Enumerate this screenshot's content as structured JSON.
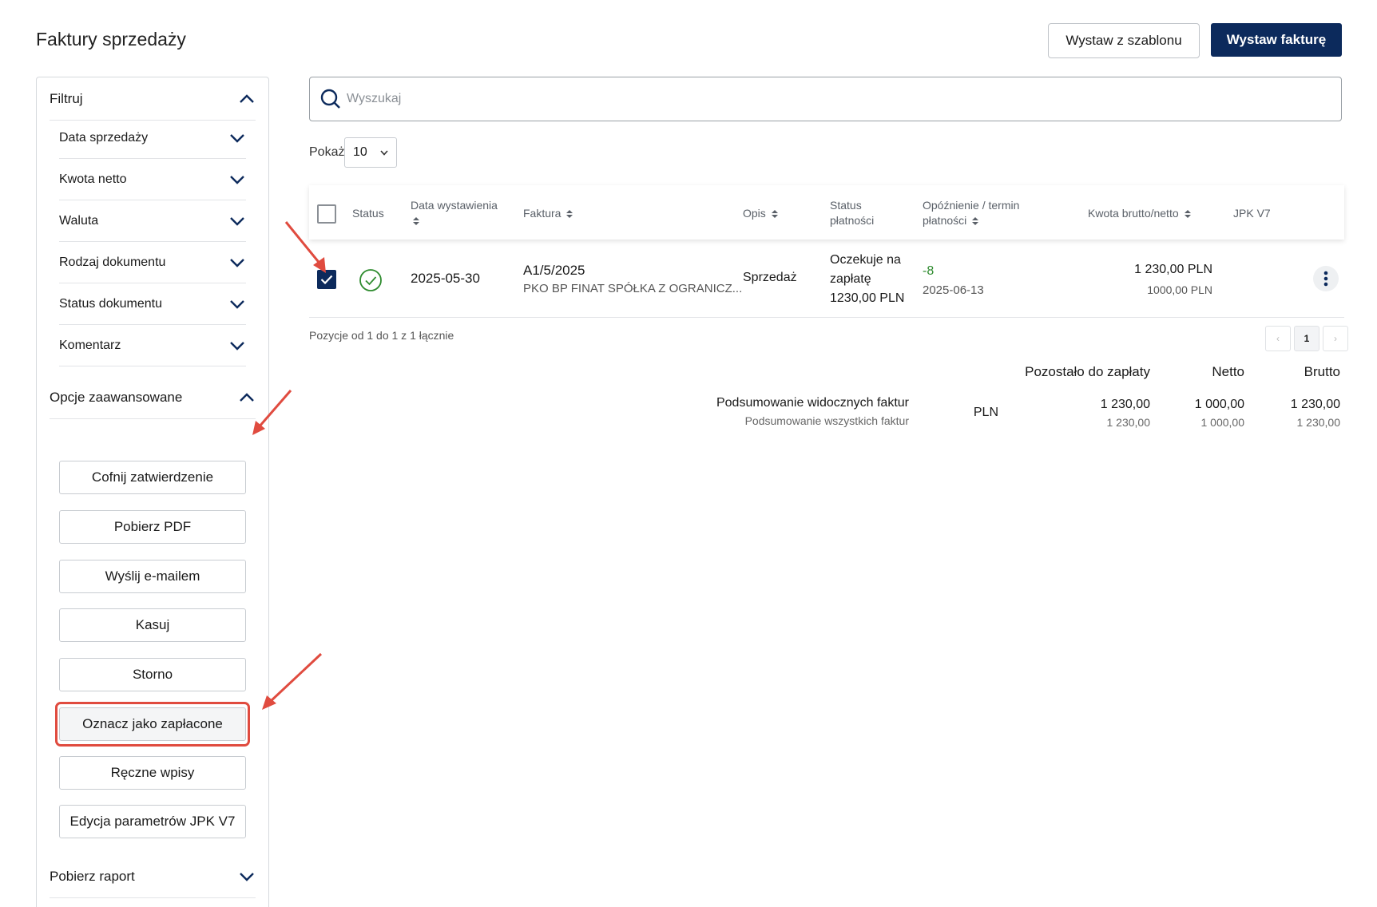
{
  "header": {
    "title": "Faktury sprzedaży",
    "btn_template": "Wystaw z szablonu",
    "btn_issue": "Wystaw fakturę"
  },
  "sidebar": {
    "filter_title": "Filtruj",
    "filters": [
      "Data sprzedaży",
      "Kwota netto",
      "Waluta",
      "Rodzaj dokumentu",
      "Status dokumentu",
      "Komentarz"
    ],
    "advanced_title": "Opcje zaawansowane",
    "advanced_buttons": [
      "Cofnij zatwierdzenie",
      "Pobierz PDF",
      "Wyślij e-mailem",
      "Kasuj",
      "Storno",
      "Oznacz jako zapłacone",
      "Ręczne wpisy",
      "Edycja parametrów JPK V7"
    ],
    "report_title": "Pobierz raport"
  },
  "search": {
    "placeholder": "Wyszukaj"
  },
  "pagesize": {
    "label": "Pokaż",
    "value": "10"
  },
  "table": {
    "headers": {
      "status": "Status",
      "date_line1": "Data wystawienia",
      "invoice": "Faktura",
      "desc": "Opis",
      "pay_status_line1": "Status",
      "pay_status_line2": "płatności",
      "delay_line1": "Opóźnienie / termin",
      "delay_line2": "płatności",
      "amount": "Kwota brutto/netto",
      "jpk": "JPK V7"
    },
    "row": {
      "date": "2025-05-30",
      "invoice_no": "A1/5/2025",
      "client": "PKO BP FINAT SPÓŁKA Z OGRANICZ...",
      "desc": "Sprzedaż",
      "pay_line1": "Oczekuje na",
      "pay_line2": "zapłatę",
      "pay_line3": "1230,00 PLN",
      "delay": "-8",
      "due": "2025-06-13",
      "gross": "1 230,00 PLN",
      "net": "1000,00 PLN"
    }
  },
  "pagination": {
    "text": "Pozycje od 1 do 1 z 1 łącznie",
    "current": "1",
    "prev": "‹",
    "next": "›"
  },
  "summary": {
    "col_remaining": "Pozostało do zapłaty",
    "col_net": "Netto",
    "col_gross": "Brutto",
    "row1_label": "Podsumowanie widocznych faktur",
    "row2_label": "Podsumowanie wszystkich faktur",
    "currency": "PLN",
    "remaining1": "1 230,00",
    "remaining2": "1 230,00",
    "net1": "1 000,00",
    "net2": "1 000,00",
    "gross1": "1 230,00",
    "gross2": "1 230,00"
  },
  "colors": {
    "primary": "#0c2a5c",
    "highlight": "#e04b3f",
    "success": "#2e8b2e"
  }
}
